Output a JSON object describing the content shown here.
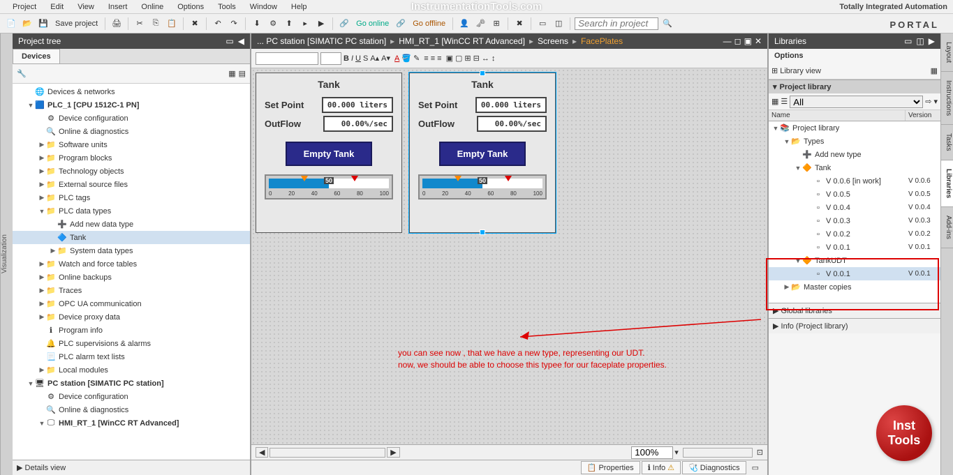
{
  "menu": {
    "items": [
      "Project",
      "Edit",
      "View",
      "Insert",
      "Online",
      "Options",
      "Tools",
      "Window",
      "Help"
    ]
  },
  "watermark": "InstrumentationTools.com",
  "header_right": "Totally Integrated Automation",
  "portal": "PORTAL",
  "toolbar": {
    "save": "Save project",
    "go_online": "Go online",
    "go_offline": "Go offline",
    "search_placeholder": "Search in project"
  },
  "project_tree": {
    "title": "Project tree",
    "tab": "Devices",
    "items": [
      {
        "txt": "Devices & networks",
        "lvl": 1,
        "ico": "net"
      },
      {
        "txt": "PLC_1 [CPU 1512C-1 PN]",
        "lvl": 1,
        "exp": "▼",
        "bold": true,
        "ico": "plc"
      },
      {
        "txt": "Device configuration",
        "lvl": 2,
        "ico": "dev"
      },
      {
        "txt": "Online & diagnostics",
        "lvl": 2,
        "ico": "diag"
      },
      {
        "txt": "Software units",
        "lvl": 2,
        "exp": "▶",
        "ico": "fold"
      },
      {
        "txt": "Program blocks",
        "lvl": 2,
        "exp": "▶",
        "ico": "fold"
      },
      {
        "txt": "Technology objects",
        "lvl": 2,
        "exp": "▶",
        "ico": "fold"
      },
      {
        "txt": "External source files",
        "lvl": 2,
        "exp": "▶",
        "ico": "fold"
      },
      {
        "txt": "PLC tags",
        "lvl": 2,
        "exp": "▶",
        "ico": "fold"
      },
      {
        "txt": "PLC data types",
        "lvl": 2,
        "exp": "▼",
        "ico": "fold"
      },
      {
        "txt": "Add new data type",
        "lvl": 3,
        "ico": "add"
      },
      {
        "txt": "Tank",
        "lvl": 3,
        "ico": "udt",
        "sel": true
      },
      {
        "txt": "System data types",
        "lvl": 3,
        "exp": "▶",
        "ico": "fold"
      },
      {
        "txt": "Watch and force tables",
        "lvl": 2,
        "exp": "▶",
        "ico": "fold"
      },
      {
        "txt": "Online backups",
        "lvl": 2,
        "exp": "▶",
        "ico": "fold"
      },
      {
        "txt": "Traces",
        "lvl": 2,
        "exp": "▶",
        "ico": "fold"
      },
      {
        "txt": "OPC UA communication",
        "lvl": 2,
        "exp": "▶",
        "ico": "fold"
      },
      {
        "txt": "Device proxy data",
        "lvl": 2,
        "exp": "▶",
        "ico": "fold"
      },
      {
        "txt": "Program info",
        "lvl": 2,
        "ico": "info"
      },
      {
        "txt": "PLC supervisions & alarms",
        "lvl": 2,
        "ico": "alarm"
      },
      {
        "txt": "PLC alarm text lists",
        "lvl": 2,
        "ico": "list"
      },
      {
        "txt": "Local modules",
        "lvl": 2,
        "exp": "▶",
        "ico": "fold"
      },
      {
        "txt": "PC station [SIMATIC PC station]",
        "lvl": 1,
        "exp": "▼",
        "bold": true,
        "ico": "pc"
      },
      {
        "txt": "Device configuration",
        "lvl": 2,
        "ico": "dev"
      },
      {
        "txt": "Online & diagnostics",
        "lvl": 2,
        "ico": "diag"
      },
      {
        "txt": "HMI_RT_1 [WinCC RT Advanced]",
        "lvl": 2,
        "exp": "▼",
        "bold": true,
        "ico": "hmi"
      }
    ],
    "details": "Details view"
  },
  "breadcrumb": {
    "parts": [
      "... PC station [SIMATIC PC station]",
      "HMI_RT_1 [WinCC RT Advanced]",
      "Screens",
      "FacePlates"
    ]
  },
  "faceplate": {
    "title": "Tank",
    "setpoint_label": "Set Point",
    "setpoint_value": "00.000 liters",
    "outflow_label": "OutFlow",
    "outflow_value": "00.00%/sec",
    "button": "Empty Tank",
    "slider_center": "50",
    "ticks": [
      "0",
      "20",
      "40",
      "60",
      "80",
      "100"
    ]
  },
  "annotation": {
    "line1": "you can see now , that we have a new type, representing our UDT.",
    "line2": "now, we should be able to choose this typee for our faceplate properties."
  },
  "status": {
    "zoom": "100%",
    "properties": "Properties",
    "info": "Info",
    "diagnostics": "Diagnostics"
  },
  "libraries": {
    "title": "Libraries",
    "options": "Options",
    "library_view": "Library view",
    "project_library": "Project library",
    "filter_all": "All",
    "cols": {
      "name": "Name",
      "version": "Version"
    },
    "tree": [
      {
        "txt": "Project library",
        "lvl": 0,
        "exp": "▼",
        "ico": "lib"
      },
      {
        "txt": "Types",
        "lvl": 1,
        "exp": "▼",
        "ico": "foldo"
      },
      {
        "txt": "Add new type",
        "lvl": 2,
        "ico": "add"
      },
      {
        "txt": "Tank",
        "lvl": 2,
        "exp": "▼",
        "ico": "type"
      },
      {
        "txt": "V 0.0.6 [in work]",
        "lvl": 3,
        "ver": "V 0.0.6",
        "ico": "ver"
      },
      {
        "txt": "V 0.0.5",
        "lvl": 3,
        "ver": "V 0.0.5",
        "ico": "ver"
      },
      {
        "txt": "V 0.0.4",
        "lvl": 3,
        "ver": "V 0.0.4",
        "ico": "ver"
      },
      {
        "txt": "V 0.0.3",
        "lvl": 3,
        "ver": "V 0.0.3",
        "ico": "ver"
      },
      {
        "txt": "V 0.0.2",
        "lvl": 3,
        "ver": "V 0.0.2",
        "ico": "ver"
      },
      {
        "txt": "V 0.0.1",
        "lvl": 3,
        "ver": "V 0.0.1",
        "ico": "ver"
      },
      {
        "txt": "TankUDT",
        "lvl": 2,
        "exp": "▼",
        "ico": "type"
      },
      {
        "txt": "V 0.0.1",
        "lvl": 3,
        "ver": "V 0.0.1",
        "ico": "ver",
        "sel": true
      },
      {
        "txt": "Master copies",
        "lvl": 1,
        "exp": "▶",
        "ico": "foldo"
      }
    ],
    "global": "Global libraries",
    "info_pl": "Info (Project library)"
  },
  "right_tabs": [
    "Layout",
    "Instructions",
    "Tasks",
    "Libraries",
    "Add-ins"
  ],
  "inst_logo": {
    "l1": "Inst",
    "l2": "Tools"
  }
}
